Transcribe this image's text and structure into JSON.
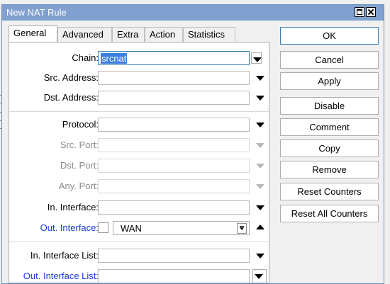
{
  "window": {
    "title": "New NAT Rule"
  },
  "tabs": [
    {
      "label": "General"
    },
    {
      "label": "Advanced"
    },
    {
      "label": "Extra"
    },
    {
      "label": "Action"
    },
    {
      "label": "Statistics"
    }
  ],
  "fields": {
    "chain": {
      "label": "Chain:",
      "value": "srcnat"
    },
    "src_address": {
      "label": "Src. Address:"
    },
    "dst_address": {
      "label": "Dst. Address:"
    },
    "protocol": {
      "label": "Protocol:"
    },
    "src_port": {
      "label": "Src. Port:"
    },
    "dst_port": {
      "label": "Dst. Port:"
    },
    "any_port": {
      "label": "Any. Port:"
    },
    "in_interface": {
      "label": "In. Interface:"
    },
    "out_interface": {
      "label": "Out. Interface:",
      "value": "WAN",
      "negated": false
    },
    "in_interface_list": {
      "label": "In. Interface List:"
    },
    "out_interface_list": {
      "label": "Out. Interface List:"
    }
  },
  "buttons": {
    "ok": "OK",
    "cancel": "Cancel",
    "apply": "Apply",
    "disable": "Disable",
    "comment": "Comment",
    "copy": "Copy",
    "remove": "Remove",
    "reset_counters": "Reset Counters",
    "reset_all_counters": "Reset All Counters"
  },
  "colors": {
    "titlebar": "#80a0cf",
    "link_label": "#1a3dd6",
    "selection": "#3c7ee0"
  }
}
